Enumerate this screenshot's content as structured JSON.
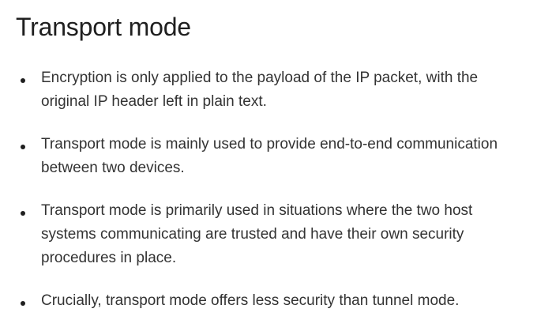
{
  "heading": "Transport mode",
  "bullets": [
    "Encryption is only applied to the payload of the IP packet, with the original IP header left in plain text.",
    "Transport mode is mainly used to provide end-to-end communication between two devices.",
    "Transport mode is primarily used in situations where the two host systems communicating are trusted and have their own security procedures in place.",
    "Crucially, transport mode offers less security than tunnel mode."
  ]
}
